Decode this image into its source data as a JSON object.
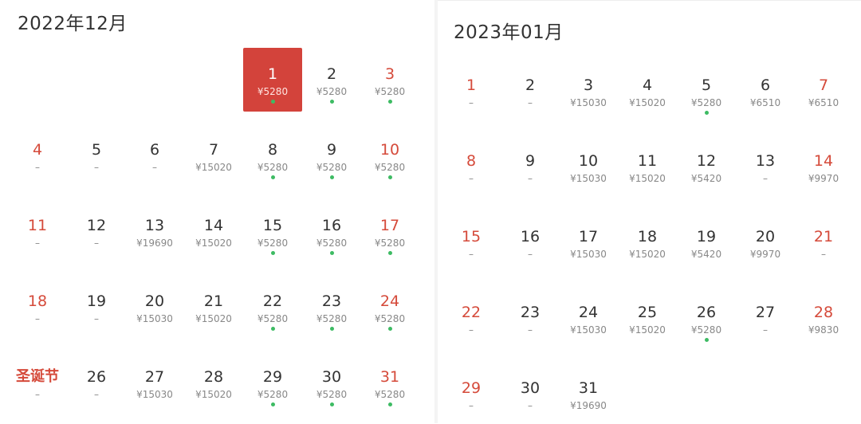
{
  "colors": {
    "accent": "#d3433b",
    "weekend": "#d54a3a",
    "available_dot": "#3dbb63",
    "text": "#333333",
    "muted": "#888888"
  },
  "months": [
    {
      "title": "2022年12月",
      "lead_blanks": 4,
      "days": [
        {
          "label": "1",
          "price": "¥5280",
          "dot": true,
          "weekend": false,
          "selected": true
        },
        {
          "label": "2",
          "price": "¥5280",
          "dot": true,
          "weekend": false
        },
        {
          "label": "3",
          "price": "¥5280",
          "dot": true,
          "weekend": true
        },
        {
          "label": "4",
          "price": "–",
          "dot": false,
          "weekend": true
        },
        {
          "label": "5",
          "price": "–",
          "dot": false,
          "weekend": false
        },
        {
          "label": "6",
          "price": "–",
          "dot": false,
          "weekend": false
        },
        {
          "label": "7",
          "price": "¥15020",
          "dot": false,
          "weekend": false
        },
        {
          "label": "8",
          "price": "¥5280",
          "dot": true,
          "weekend": false
        },
        {
          "label": "9",
          "price": "¥5280",
          "dot": true,
          "weekend": false
        },
        {
          "label": "10",
          "price": "¥5280",
          "dot": true,
          "weekend": true
        },
        {
          "label": "11",
          "price": "–",
          "dot": false,
          "weekend": true
        },
        {
          "label": "12",
          "price": "–",
          "dot": false,
          "weekend": false
        },
        {
          "label": "13",
          "price": "¥19690",
          "dot": false,
          "weekend": false
        },
        {
          "label": "14",
          "price": "¥15020",
          "dot": false,
          "weekend": false
        },
        {
          "label": "15",
          "price": "¥5280",
          "dot": true,
          "weekend": false
        },
        {
          "label": "16",
          "price": "¥5280",
          "dot": true,
          "weekend": false
        },
        {
          "label": "17",
          "price": "¥5280",
          "dot": true,
          "weekend": true
        },
        {
          "label": "18",
          "price": "–",
          "dot": false,
          "weekend": true
        },
        {
          "label": "19",
          "price": "–",
          "dot": false,
          "weekend": false
        },
        {
          "label": "20",
          "price": "¥15030",
          "dot": false,
          "weekend": false
        },
        {
          "label": "21",
          "price": "¥15020",
          "dot": false,
          "weekend": false
        },
        {
          "label": "22",
          "price": "¥5280",
          "dot": true,
          "weekend": false
        },
        {
          "label": "23",
          "price": "¥5280",
          "dot": true,
          "weekend": false
        },
        {
          "label": "24",
          "price": "¥5280",
          "dot": true,
          "weekend": true
        },
        {
          "label": "圣诞节",
          "price": "–",
          "dot": false,
          "weekend": true,
          "holiday": true
        },
        {
          "label": "26",
          "price": "–",
          "dot": false,
          "weekend": false
        },
        {
          "label": "27",
          "price": "¥15030",
          "dot": false,
          "weekend": false
        },
        {
          "label": "28",
          "price": "¥15020",
          "dot": false,
          "weekend": false
        },
        {
          "label": "29",
          "price": "¥5280",
          "dot": true,
          "weekend": false
        },
        {
          "label": "30",
          "price": "¥5280",
          "dot": true,
          "weekend": false
        },
        {
          "label": "31",
          "price": "¥5280",
          "dot": true,
          "weekend": true
        }
      ]
    },
    {
      "title": "2023年01月",
      "lead_blanks": 0,
      "days": [
        {
          "label": "1",
          "price": "–",
          "dot": false,
          "weekend": true
        },
        {
          "label": "2",
          "price": "–",
          "dot": false,
          "weekend": false
        },
        {
          "label": "3",
          "price": "¥15030",
          "dot": false,
          "weekend": false
        },
        {
          "label": "4",
          "price": "¥15020",
          "dot": false,
          "weekend": false
        },
        {
          "label": "5",
          "price": "¥5280",
          "dot": true,
          "weekend": false
        },
        {
          "label": "6",
          "price": "¥6510",
          "dot": false,
          "weekend": false
        },
        {
          "label": "7",
          "price": "¥6510",
          "dot": false,
          "weekend": true
        },
        {
          "label": "8",
          "price": "–",
          "dot": false,
          "weekend": true
        },
        {
          "label": "9",
          "price": "–",
          "dot": false,
          "weekend": false
        },
        {
          "label": "10",
          "price": "¥15030",
          "dot": false,
          "weekend": false
        },
        {
          "label": "11",
          "price": "¥15020",
          "dot": false,
          "weekend": false
        },
        {
          "label": "12",
          "price": "¥5420",
          "dot": false,
          "weekend": false
        },
        {
          "label": "13",
          "price": "–",
          "dot": false,
          "weekend": false
        },
        {
          "label": "14",
          "price": "¥9970",
          "dot": false,
          "weekend": true
        },
        {
          "label": "15",
          "price": "–",
          "dot": false,
          "weekend": true
        },
        {
          "label": "16",
          "price": "–",
          "dot": false,
          "weekend": false
        },
        {
          "label": "17",
          "price": "¥15030",
          "dot": false,
          "weekend": false
        },
        {
          "label": "18",
          "price": "¥15020",
          "dot": false,
          "weekend": false
        },
        {
          "label": "19",
          "price": "¥5420",
          "dot": false,
          "weekend": false
        },
        {
          "label": "20",
          "price": "¥9970",
          "dot": false,
          "weekend": false
        },
        {
          "label": "21",
          "price": "–",
          "dot": false,
          "weekend": true
        },
        {
          "label": "22",
          "price": "–",
          "dot": false,
          "weekend": true
        },
        {
          "label": "23",
          "price": "–",
          "dot": false,
          "weekend": false
        },
        {
          "label": "24",
          "price": "¥15030",
          "dot": false,
          "weekend": false
        },
        {
          "label": "25",
          "price": "¥15020",
          "dot": false,
          "weekend": false
        },
        {
          "label": "26",
          "price": "¥5280",
          "dot": true,
          "weekend": false
        },
        {
          "label": "27",
          "price": "–",
          "dot": false,
          "weekend": false
        },
        {
          "label": "28",
          "price": "¥9830",
          "dot": false,
          "weekend": true
        },
        {
          "label": "29",
          "price": "–",
          "dot": false,
          "weekend": true
        },
        {
          "label": "30",
          "price": "–",
          "dot": false,
          "weekend": false
        },
        {
          "label": "31",
          "price": "¥19690",
          "dot": false,
          "weekend": false
        }
      ]
    }
  ]
}
